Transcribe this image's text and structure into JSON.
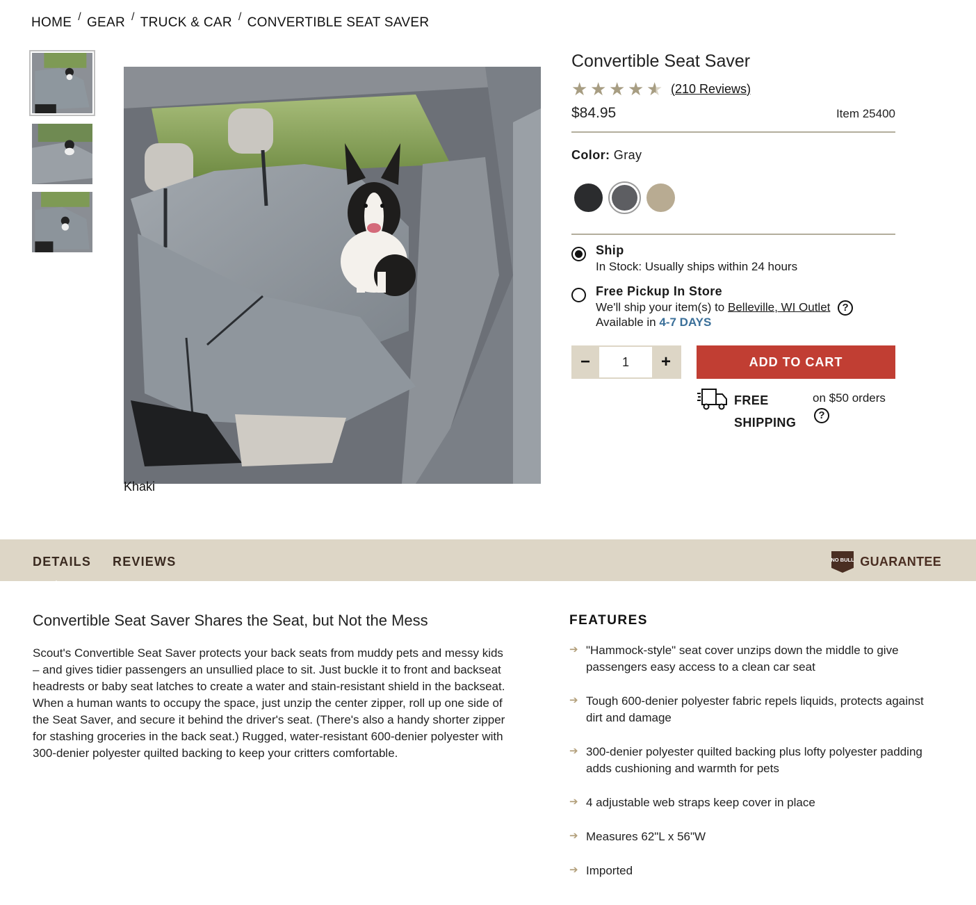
{
  "breadcrumb": {
    "items": [
      "HOME",
      "GEAR",
      "TRUCK & CAR",
      "CONVERTIBLE SEAT SAVER"
    ],
    "separator": "/"
  },
  "gallery": {
    "thumbnails": [
      "thumb-1",
      "thumb-2",
      "thumb-3"
    ],
    "selected_index": 0,
    "alt_text": "Khaki"
  },
  "product": {
    "title": "Convertible Seat Saver",
    "rating": 4.5,
    "reviews_label": "(210 Reviews)",
    "price": "$84.95",
    "item_number": "Item 25400",
    "color_label": "Color:",
    "color_value": "Gray",
    "swatches": [
      {
        "name": "Black",
        "hex": "#2b2c2e"
      },
      {
        "name": "Gray",
        "hex": "#5d5e62",
        "selected": true
      },
      {
        "name": "Khaki",
        "hex": "#b8ab92"
      }
    ]
  },
  "fulfillment": {
    "ship": {
      "title": "Ship",
      "text": "In Stock: Usually ships within 24 hours",
      "selected": true
    },
    "pickup": {
      "title": "Free Pickup In Store",
      "text_prefix": "We'll ship your item(s) to",
      "store": "Belleville, WI Outlet",
      "available_prefix": "Available in",
      "days": "4-7 DAYS",
      "selected": false
    }
  },
  "cart": {
    "minus": "−",
    "quantity": "1",
    "plus": "+",
    "add_label": "ADD TO CART"
  },
  "shipping": {
    "label": "FREE SHIPPING",
    "note": "on $50 orders",
    "help": "?"
  },
  "tabs": {
    "details": "DETAILS",
    "reviews": "REVIEWS",
    "guarantee_badge": "NO BULL",
    "guarantee": "GUARANTEE"
  },
  "details": {
    "heading": "Convertible Seat Saver Shares the Seat, but Not the Mess",
    "body": "Scout's Convertible Seat Saver protects your back seats from muddy pets and messy kids – and gives tidier passengers an unsullied place to sit. Just buckle it to front and backseat headrests or baby seat latches to create a water and stain-resistant shield in the backseat. When a human wants to occupy the space, just unzip the center zipper, roll up one side of the Seat Saver, and secure it behind the driver's seat. (There's also a handy shorter zipper for stashing groceries in the back seat.) Rugged, water-resistant 600-denier polyester with 300-denier polyester quilted backing to keep your critters comfortable."
  },
  "features": {
    "heading": "FEATURES",
    "items": [
      "\"Hammock-style\" seat cover unzips down the middle to give passengers easy access to a clean car seat",
      "Tough 600-denier polyester fabric repels liquids, protects against dirt and damage",
      "300-denier polyester quilted backing plus lofty polyester padding adds cushioning and warmth for pets",
      "4 adjustable web straps keep cover in place",
      "Measures 62\"L x 56\"W",
      "Imported"
    ]
  },
  "colors": {
    "accent_red": "#c13e33",
    "tab_bg": "#ddd6c6",
    "star": "#a79d82",
    "link_blue": "#3a6f99"
  }
}
